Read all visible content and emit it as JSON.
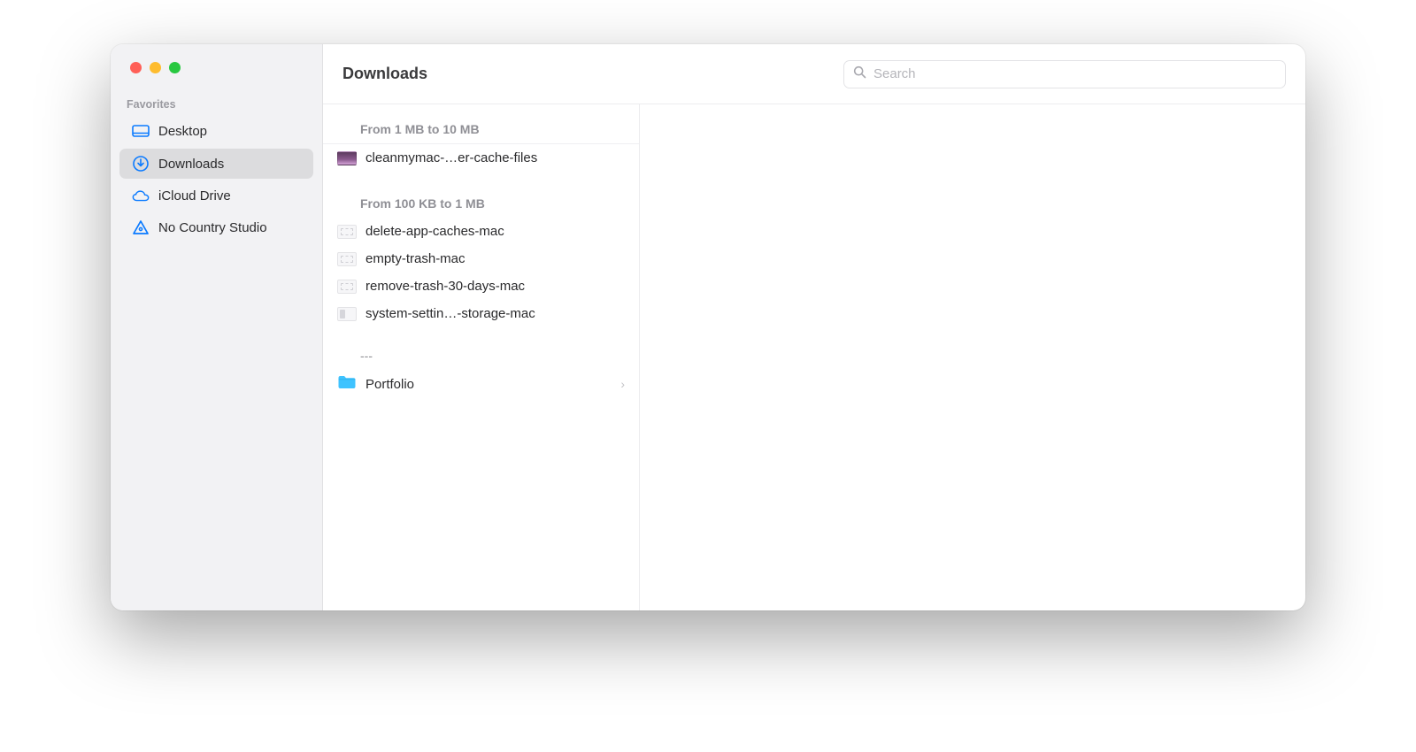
{
  "sidebar": {
    "section_label": "Favorites",
    "items": [
      {
        "label": "Desktop",
        "icon": "desktop-icon",
        "active": false
      },
      {
        "label": "Downloads",
        "icon": "downloads-icon",
        "active": true
      },
      {
        "label": "iCloud Drive",
        "icon": "cloud-icon",
        "active": false
      },
      {
        "label": "No Country Studio",
        "icon": "triangle-icon",
        "active": false
      }
    ]
  },
  "titlebar": {
    "title": "Downloads",
    "search_placeholder": "Search"
  },
  "file_list": {
    "groups": [
      {
        "header": "From 1 MB to 10 MB",
        "items": [
          {
            "name": "cleanmymac-…er-cache-files",
            "thumb": "image"
          }
        ]
      },
      {
        "header": "From 100 KB to 1 MB",
        "items": [
          {
            "name": "delete-app-caches-mac",
            "thumb": "placeholder"
          },
          {
            "name": "empty-trash-mac",
            "thumb": "placeholder"
          },
          {
            "name": "remove-trash-30-days-mac",
            "thumb": "placeholder"
          },
          {
            "name": "system-settin…-storage-mac",
            "thumb": "settings"
          }
        ]
      }
    ],
    "misc_header": "---",
    "folders": [
      {
        "name": "Portfolio"
      }
    ]
  }
}
